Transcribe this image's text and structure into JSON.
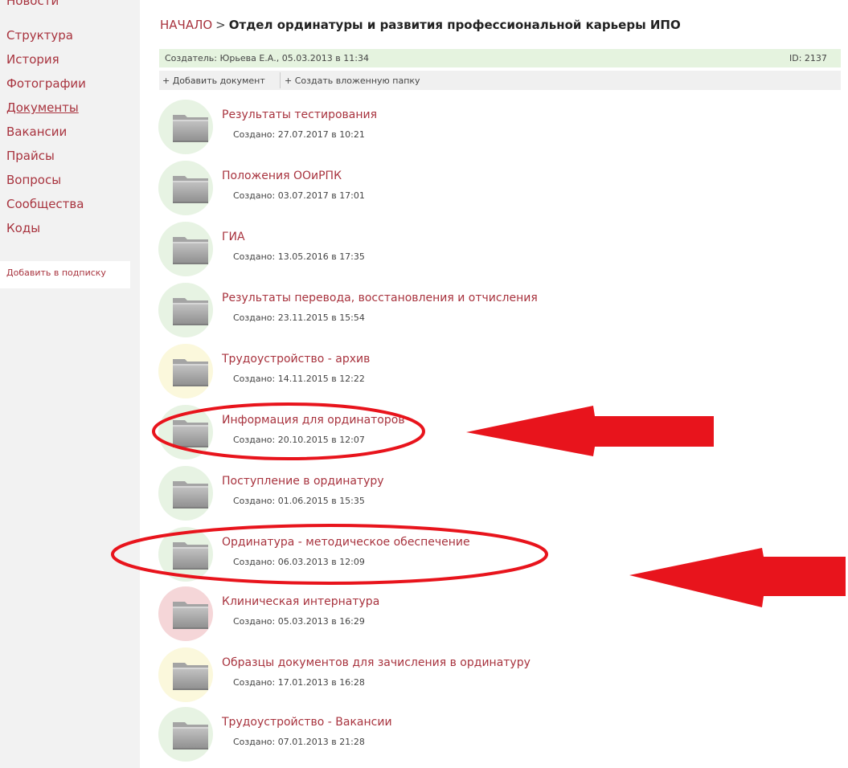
{
  "sidebar": {
    "items": [
      {
        "label": "Новости"
      },
      {
        "label": "Структура"
      },
      {
        "label": "История"
      },
      {
        "label": "Фотографии"
      },
      {
        "label": "Документы"
      },
      {
        "label": "Вакансии"
      },
      {
        "label": "Прайсы"
      },
      {
        "label": "Вопросы"
      },
      {
        "label": "Сообщества"
      },
      {
        "label": "Коды"
      }
    ],
    "active_item": "Документы",
    "subscribe_label": "Добавить в подписку"
  },
  "breadcrumb": {
    "home": "НАЧАЛО",
    "separator": ">",
    "current": "Отдел ординатуры и развития профессиональной карьеры ИПО"
  },
  "meta": {
    "creator": "Создатель: Юрьева Е.А., 05.03.2013 в 11:34",
    "id": "ID: 2137"
  },
  "actions": {
    "add_document": "+ Добавить документ",
    "create_folder": "+ Создать вложенную папку"
  },
  "folders": [
    {
      "title": "Результаты тестирования",
      "created": "Создано: 27.07.2017 в 10:21",
      "status_color": "#e7f3e3"
    },
    {
      "title": "Положения ООиРПК",
      "created": "Создано: 03.07.2017 в 17:01",
      "status_color": "#e7f3e3"
    },
    {
      "title": "ГИА",
      "created": "Создано: 13.05.2016 в 17:35",
      "status_color": "#e7f3e3"
    },
    {
      "title": "Результаты перевода, восстановления и отчисления",
      "created": "Создано: 23.11.2015 в 15:54",
      "status_color": "#e7f3e3"
    },
    {
      "title": "Трудоустройство - архив",
      "created": "Создано: 14.11.2015 в 12:22",
      "status_color": "#fbf8dc"
    },
    {
      "title": "Информация для ординаторов",
      "created": "Создано: 20.10.2015 в 12:07",
      "status_color": "#e7f3e3"
    },
    {
      "title": "Поступление в ординатуру",
      "created": "Создано: 01.06.2015 в 15:35",
      "status_color": "#e7f3e3"
    },
    {
      "title": "Ординатура - методическое обеспечение",
      "created": "Создано: 06.03.2013 в 12:09",
      "status_color": "#e7f3e3"
    },
    {
      "title": "Клиническая интернатура",
      "created": "Создано: 05.03.2013 в 16:29",
      "status_color": "#f5d6d8"
    },
    {
      "title": "Образцы документов для зачисления в ординатуру",
      "created": "Создано: 17.01.2013 в 16:28",
      "status_color": "#fbf8dc"
    },
    {
      "title": "Трудоустройство - Вакансии",
      "created": "Создано: 07.01.2013 в 21:28",
      "status_color": "#e7f3e3"
    }
  ],
  "colors": {
    "link": "#a8333e",
    "annotation_red": "#e8141c",
    "meta_bar": "#e5f3df"
  }
}
